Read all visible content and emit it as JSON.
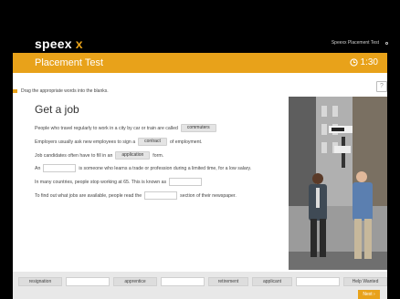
{
  "brand": {
    "logo_main": "speex",
    "logo_accent": "x"
  },
  "topbar": {
    "title": "Speexx Placement Test"
  },
  "header": {
    "title": "Placement Test",
    "timer": "1:30"
  },
  "instruction": "Drag the appropriate words into the blanks.",
  "exercise": {
    "title": "Get a job",
    "sentences": [
      {
        "before": "People who travel regularly to work in a city by car or train are called",
        "answer": "commuters",
        "after": ""
      },
      {
        "before": "Employers usually ask new employees to sign a",
        "answer": "contract",
        "after": "of employment."
      },
      {
        "before": "Job candidates often have to fill in an",
        "answer": "application",
        "after": "form."
      },
      {
        "before": "An",
        "answer": "",
        "after": "is someone who learns a trade or profession during a limited time, for a low salary."
      },
      {
        "before": "In many countries, people stop working at 65.  This is known as",
        "answer": "",
        "after": ""
      },
      {
        "before": "To find out what jobs are available, people read the",
        "answer": "",
        "after": "section of their newspaper."
      }
    ]
  },
  "wordbank": {
    "items": [
      "resignation",
      "",
      "apprentice",
      "",
      "retirement",
      "applicant",
      "",
      "Help Wanted"
    ]
  },
  "footer": {
    "next_label": "Next"
  },
  "colors": {
    "accent": "#e8a21a",
    "background": "#000000"
  },
  "icons": {
    "settings": "gear-icon",
    "timer": "clock-icon",
    "help": "help-icon",
    "next": "chevron-right-icon",
    "instruction": "flag-icon"
  }
}
